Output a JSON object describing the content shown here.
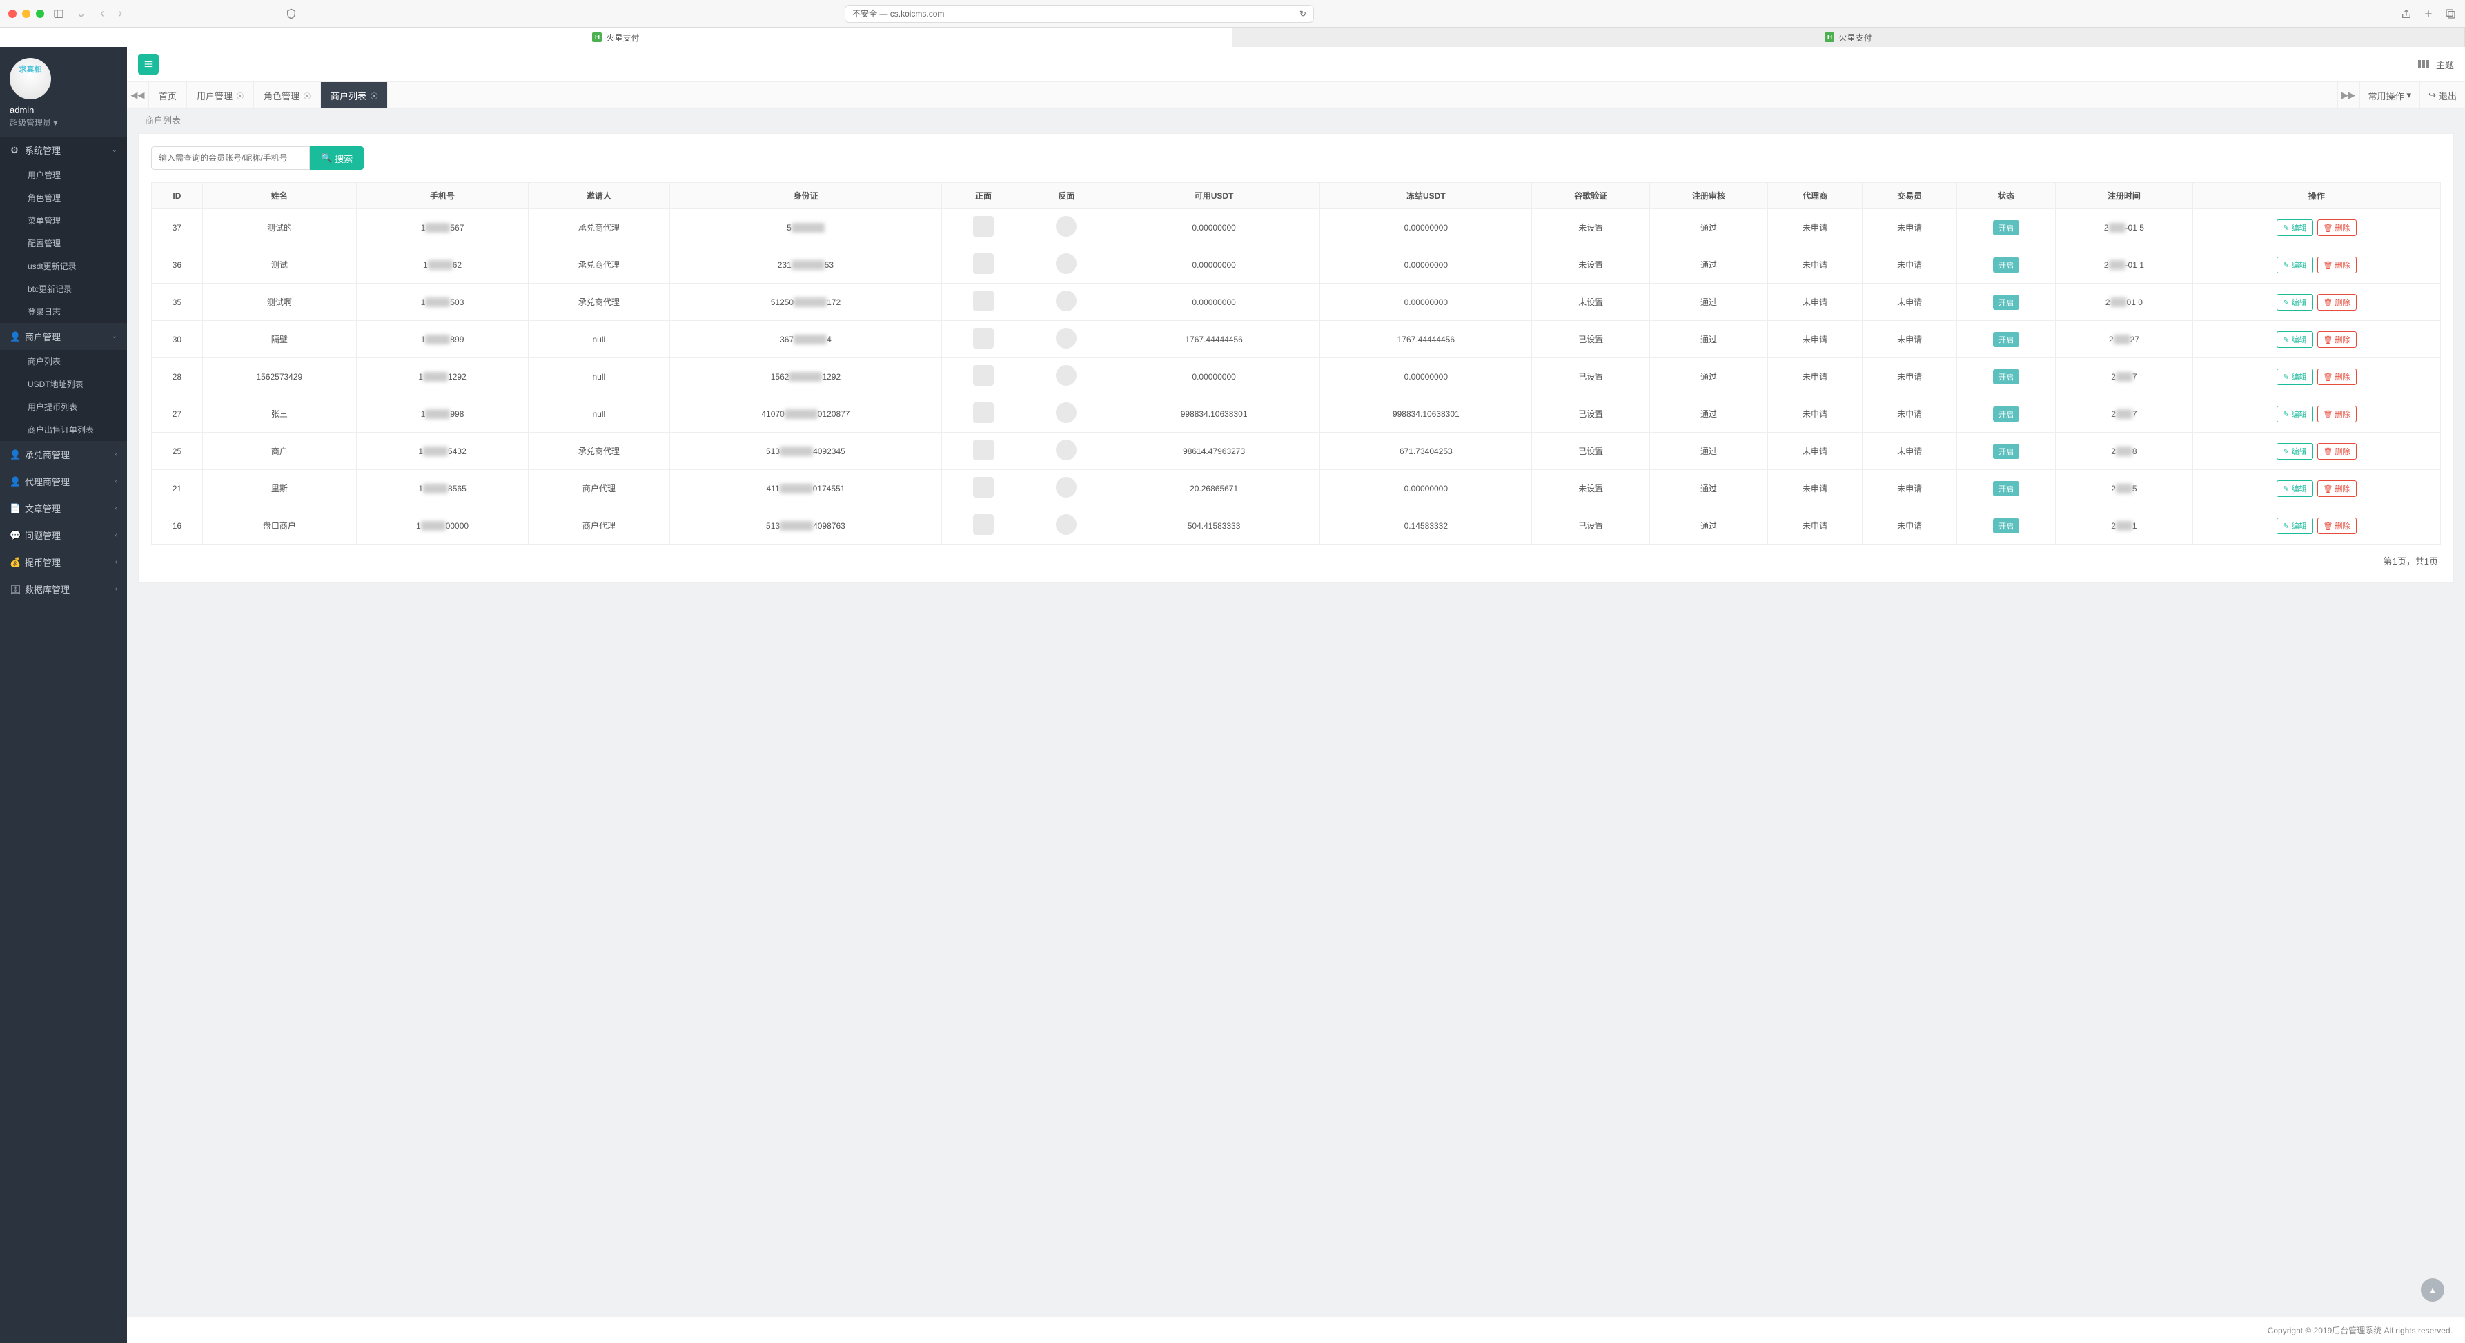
{
  "browser": {
    "address": "不安全 — cs.koicms.com",
    "tab_label": "火星支付"
  },
  "profile": {
    "avatar_text": "求真相",
    "name": "admin",
    "role": "超级管理员"
  },
  "topbar": {
    "theme_label": "主题"
  },
  "sidebar": {
    "sections": [
      {
        "icon": "⚙",
        "label": "系统管理",
        "open": true,
        "items": [
          "用户管理",
          "角色管理",
          "菜单管理",
          "配置管理",
          "usdt更新记录",
          "btc更新记录",
          "登录日志"
        ]
      },
      {
        "icon": "👤",
        "label": "商户管理",
        "open": true,
        "items": [
          "商户列表",
          "USDT地址列表",
          "用户提币列表",
          "商户出售订单列表"
        ]
      },
      {
        "icon": "👤",
        "label": "承兑商管理",
        "open": false,
        "items": []
      },
      {
        "icon": "👤",
        "label": "代理商管理",
        "open": false,
        "items": []
      },
      {
        "icon": "📄",
        "label": "文章管理",
        "open": false,
        "items": []
      },
      {
        "icon": "💬",
        "label": "问题管理",
        "open": false,
        "items": []
      },
      {
        "icon": "💰",
        "label": "提币管理",
        "open": false,
        "items": []
      },
      {
        "icon": "🗄",
        "label": "数据库管理",
        "open": false,
        "items": []
      }
    ]
  },
  "page_tabs": {
    "home": "首页",
    "tabs": [
      "用户管理",
      "角色管理",
      "商户列表"
    ],
    "active_index": 2,
    "common_ops": "常用操作",
    "logout": "退出"
  },
  "page": {
    "title": "商户列表",
    "search_placeholder": "输入需查询的会员账号/昵称/手机号",
    "search_btn": "搜索"
  },
  "table": {
    "headers": [
      "ID",
      "姓名",
      "手机号",
      "邀请人",
      "身份证",
      "正面",
      "反面",
      "可用USDT",
      "冻结USDT",
      "谷歌验证",
      "注册审核",
      "代理商",
      "交易员",
      "状态",
      "注册时间",
      "操作"
    ],
    "status_label": "开启",
    "edit_label": "编辑",
    "delete_label": "删除",
    "rows": [
      {
        "id": "37",
        "name": "测试的",
        "phone_suffix": "567",
        "inviter": "承兑商代理",
        "idcard_prefix": "5",
        "usdt_avail": "0.00000000",
        "usdt_frozen": "0.00000000",
        "google": "未设置",
        "audit": "通过",
        "agent": "未申请",
        "trader": "未申请",
        "reg_suffix": "-01 5"
      },
      {
        "id": "36",
        "name": "测试",
        "phone_suffix": "62",
        "inviter": "承兑商代理",
        "idcard_prefix": "231",
        "idcard_suffix": "53",
        "usdt_avail": "0.00000000",
        "usdt_frozen": "0.00000000",
        "google": "未设置",
        "audit": "通过",
        "agent": "未申请",
        "trader": "未申请",
        "reg_suffix": "-01 1"
      },
      {
        "id": "35",
        "name": "测试啊",
        "phone_suffix": "503",
        "inviter": "承兑商代理",
        "idcard_prefix": "51250",
        "idcard_suffix": "172",
        "usdt_avail": "0.00000000",
        "usdt_frozen": "0.00000000",
        "google": "未设置",
        "audit": "通过",
        "agent": "未申请",
        "trader": "未申请",
        "reg_suffix": "01 0"
      },
      {
        "id": "30",
        "name": "隔壁",
        "phone_suffix": "899",
        "inviter": "null",
        "idcard_prefix": "367",
        "idcard_suffix": "4",
        "usdt_avail": "1767.44444456",
        "usdt_frozen": "1767.44444456",
        "google": "已设置",
        "audit": "通过",
        "agent": "未申请",
        "trader": "未申请",
        "reg_suffix": "27"
      },
      {
        "id": "28",
        "name": "1562573429",
        "phone_suffix": "1292",
        "inviter": "null",
        "idcard_prefix": "1562",
        "idcard_suffix": "1292",
        "usdt_avail": "0.00000000",
        "usdt_frozen": "0.00000000",
        "google": "已设置",
        "audit": "通过",
        "agent": "未申请",
        "trader": "未申请",
        "reg_suffix": "7"
      },
      {
        "id": "27",
        "name": "张三",
        "phone_suffix": "998",
        "inviter": "null",
        "idcard_prefix": "41070",
        "idcard_suffix": "0120877",
        "usdt_avail": "998834.10638301",
        "usdt_frozen": "998834.10638301",
        "google": "已设置",
        "audit": "通过",
        "agent": "未申请",
        "trader": "未申请",
        "reg_suffix": "7"
      },
      {
        "id": "25",
        "name": "商户",
        "phone_suffix": "5432",
        "inviter": "承兑商代理",
        "idcard_prefix": "513",
        "idcard_suffix": "4092345",
        "usdt_avail": "98614.47963273",
        "usdt_frozen": "671.73404253",
        "google": "已设置",
        "audit": "通过",
        "agent": "未申请",
        "trader": "未申请",
        "reg_suffix": "8"
      },
      {
        "id": "21",
        "name": "里斯",
        "phone_suffix": "8565",
        "inviter": "商户代理",
        "idcard_prefix": "411",
        "idcard_suffix": "0174551",
        "usdt_avail": "20.26865671",
        "usdt_frozen": "0.00000000",
        "google": "未设置",
        "audit": "通过",
        "agent": "未申请",
        "trader": "未申请",
        "reg_suffix": "5"
      },
      {
        "id": "16",
        "name": "盘口商户",
        "phone_suffix": "00000",
        "inviter": "商户代理",
        "idcard_prefix": "513",
        "idcard_suffix": "4098763",
        "usdt_avail": "504.41583333",
        "usdt_frozen": "0.14583332",
        "google": "已设置",
        "audit": "通过",
        "agent": "未申请",
        "trader": "未申请",
        "reg_suffix": "1"
      }
    ]
  },
  "pagination": {
    "text": "第1页，共1页"
  },
  "footer": {
    "text": "Copyright © 2019后台管理系统 All rights reserved."
  }
}
